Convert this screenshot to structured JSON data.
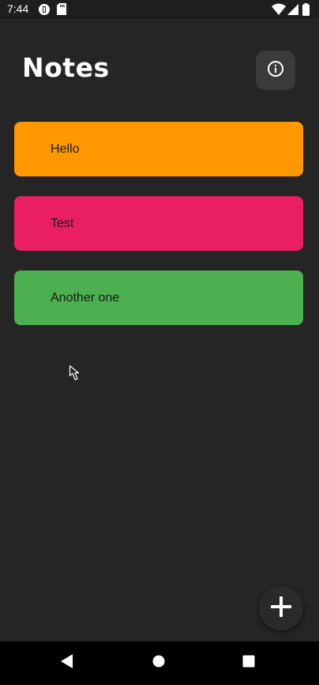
{
  "status_bar": {
    "time": "7:44"
  },
  "header": {
    "title": "Notes",
    "info_icon": "info-icon"
  },
  "notes": [
    {
      "title": "Hello",
      "color": "#FF9800"
    },
    {
      "title": "Test",
      "color": "#E91E63"
    },
    {
      "title": "Another one",
      "color": "#4CAF50"
    }
  ],
  "fab": {
    "icon": "plus-icon"
  },
  "nav_bar": {
    "back_icon": "back-icon",
    "home_icon": "home-icon",
    "recents_icon": "recents-icon"
  },
  "colors": {
    "background": "#252525",
    "info_button": "#3B3B3B",
    "fab": "#2A2A2A"
  }
}
